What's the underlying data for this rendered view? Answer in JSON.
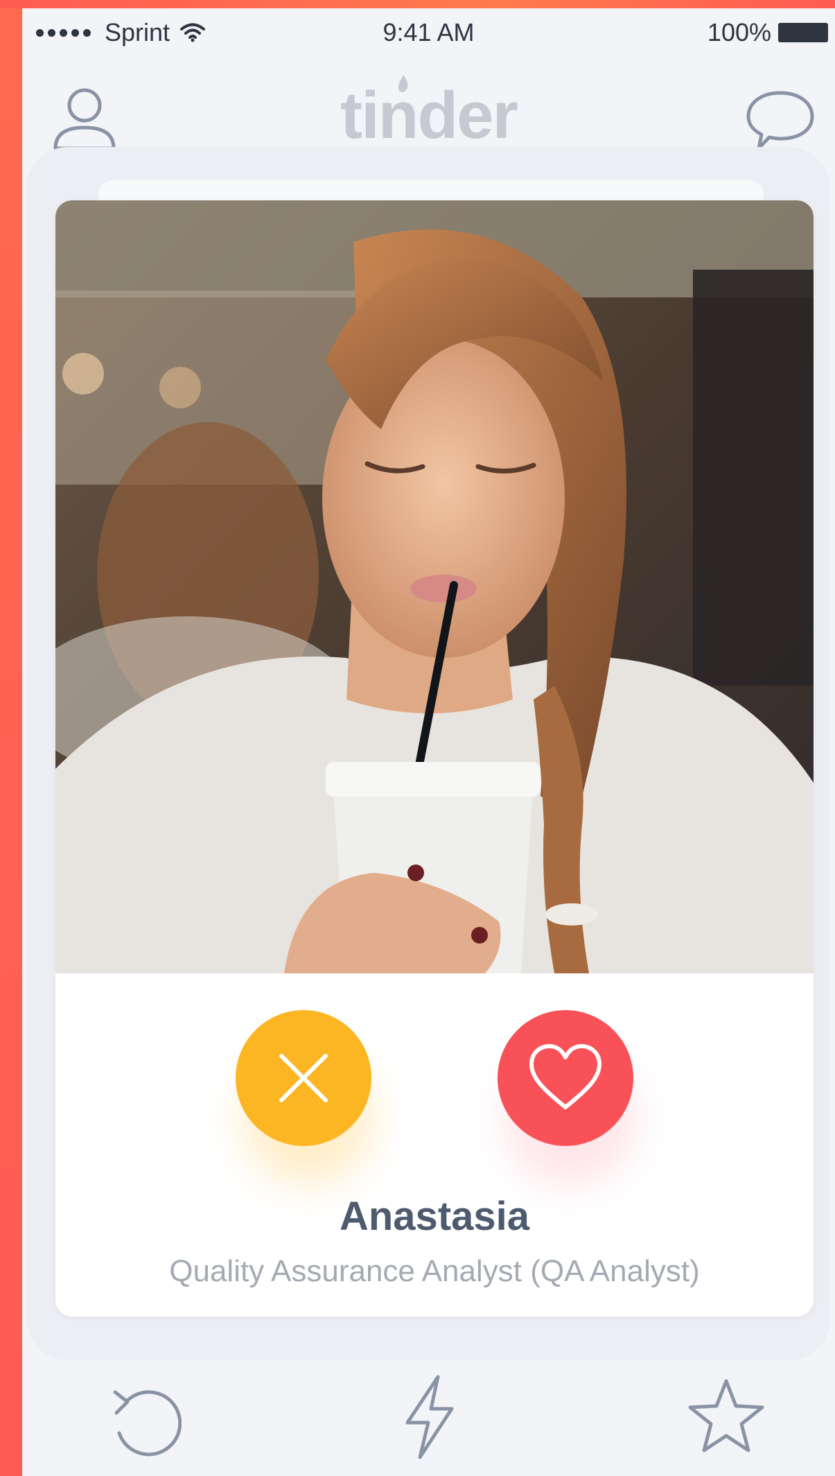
{
  "status_bar": {
    "carrier": "Sprint",
    "time": "9:41 AM",
    "battery": "100%"
  },
  "header": {
    "logo": "tinder"
  },
  "profile": {
    "name": "Anastasia",
    "job": "Quality Assurance Analyst (QA Analyst)"
  },
  "icons": {
    "profile": "user-icon",
    "chat": "chat-bubble-icon",
    "dislike": "x-icon",
    "like": "heart-icon",
    "undo": "undo-icon",
    "boost": "lightning-bolt-icon",
    "super_like": "star-icon"
  },
  "colors": {
    "frame": "#ff5b52",
    "dislike": "#fcb624",
    "like": "#f95158",
    "name": "#4e5b6e",
    "job": "#a4a9b3",
    "icon_gray": "#8a93a5"
  }
}
